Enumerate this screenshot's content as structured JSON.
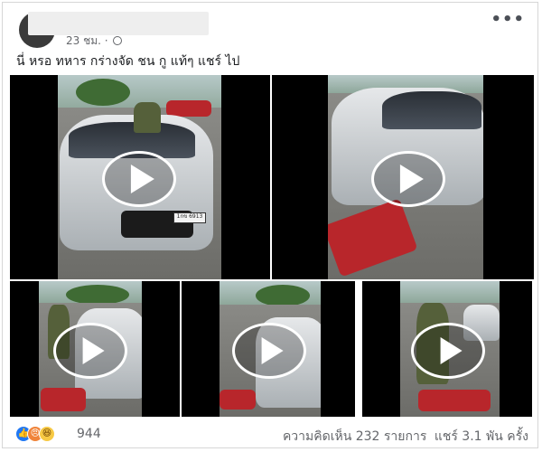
{
  "post": {
    "time": "23 ชม.",
    "caption": "นี่ หรอ ทหาร กร่างจัด ชน กู แท้ๆ แชร์ ไป",
    "more": "•••",
    "plate": "1กข 6913"
  },
  "footer": {
    "reaction_count": "944",
    "comments": "ความคิดเห็น 232 รายการ",
    "shares": "แชร์ 3.1 พัน ครั้ง"
  },
  "icons": {
    "like": "like-icon",
    "angry": "angry-icon",
    "haha": "haha-icon",
    "play": "play-icon",
    "globe": "globe-icon",
    "more": "more-icon"
  },
  "colors": {
    "like": "#2078f4",
    "angry": "#f0843a",
    "haha": "#f7c944",
    "text_muted": "#65676b"
  }
}
